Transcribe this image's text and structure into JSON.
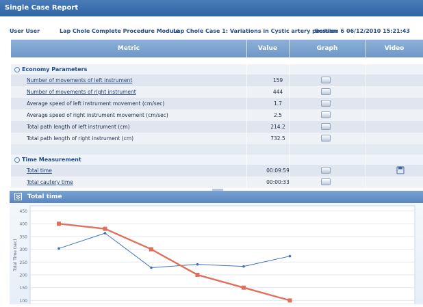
{
  "window": {
    "title": "Single Case Report"
  },
  "info": {
    "user": "User User",
    "module": "Lap Chole Complete Procedure Module",
    "case": "Lap Chole Case 1: Variations in Cystic artery position",
    "session": "Session 6",
    "datetime": "06/12/2010 15:21:43"
  },
  "table": {
    "headers": {
      "metric": "Metric",
      "value": "Value",
      "graph": "Graph",
      "video": "Video"
    },
    "sections": [
      {
        "label": "Economy Parameters",
        "rows": [
          {
            "metric": "Number of movements of left instrument",
            "value": "159",
            "link": true
          },
          {
            "metric": "Number of movements of right instrument",
            "value": "444",
            "link": true
          },
          {
            "metric": "Average speed of left instrument movement (cm/sec)",
            "value": "1.7",
            "link": false
          },
          {
            "metric": "Average speed of right instrument movement (cm/sec)",
            "value": "2.5",
            "link": false
          },
          {
            "metric": "Total path length of left instrument (cm)",
            "value": "214.2",
            "link": false
          },
          {
            "metric": "Total path length of right instrument (cm)",
            "value": "732.5",
            "link": false
          }
        ]
      },
      {
        "label": "Time Measurement",
        "rows": [
          {
            "metric": "Total time",
            "value": "00:09:59",
            "link": true,
            "video": true
          },
          {
            "metric": "Total cautery time",
            "value": "00:00:33",
            "link": true
          }
        ]
      }
    ]
  },
  "chart_panel": {
    "title": "Total time"
  },
  "chart_data": {
    "type": "line",
    "ylabel": "Total Time (sec)",
    "yticks": [
      100,
      150,
      200,
      250,
      300,
      350,
      400,
      450
    ],
    "ylim": [
      85,
      470
    ],
    "x": [
      1,
      2,
      3,
      4,
      5,
      6
    ],
    "series": [
      {
        "color": "#3c6fc2",
        "values": [
          303,
          363,
          228,
          241,
          233,
          273
        ],
        "x": [
          1,
          2,
          3,
          4,
          5,
          6
        ]
      },
      {
        "color": "#e0705c",
        "values": [
          400,
          380,
          300,
          200,
          150,
          100
        ],
        "x": [
          1,
          2,
          3,
          4,
          5,
          6
        ]
      }
    ],
    "grid": true
  }
}
